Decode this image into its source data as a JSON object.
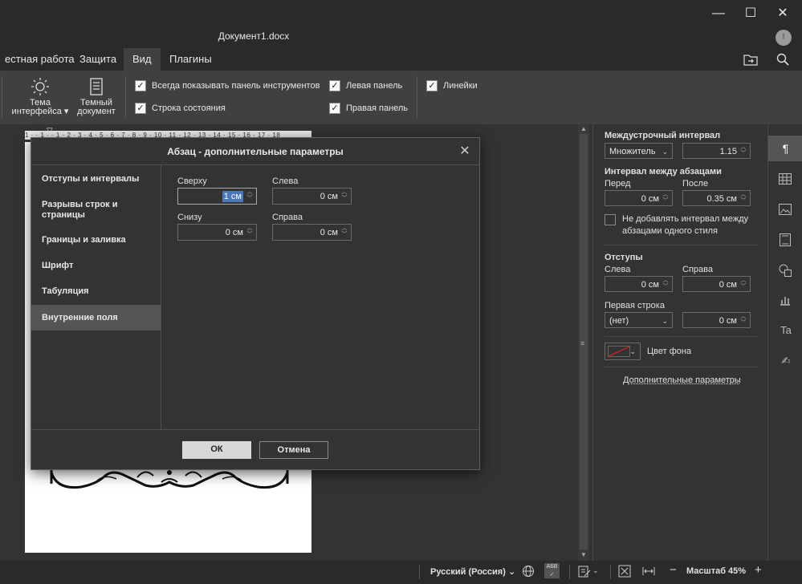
{
  "window": {
    "doc_title": "Документ1.docx",
    "avatar_initial": "I",
    "minimize": "—",
    "maximize": "☐",
    "close": "✕"
  },
  "tabs": [
    {
      "label": "естная работа"
    },
    {
      "label": "Защита"
    },
    {
      "label": "Вид"
    },
    {
      "label": "Плагины"
    }
  ],
  "toolbar": {
    "theme_label_1": "Тема",
    "theme_label_2": "интерфейса",
    "dark_label_1": "Темный",
    "dark_label_2": "документ",
    "always_show_toolbar": "Всегда показывать панель инструментов",
    "status_bar": "Строка состояния",
    "left_panel": "Левая панель",
    "right_panel": "Правая панель",
    "rulers": "Линейки"
  },
  "ruler": {
    "text": "1 · · 1 · · 1 · 2 · 3 · 4 · 5 · 6 · 7 · 8 · 9 · 10 · 11 · 12 · 13 · 14 · 15 · 16 · 17 · 18"
  },
  "right_panel": {
    "line_spacing_title": "Междустрочный интервал",
    "line_spacing_type": "Множитель",
    "line_spacing_value": "1.15",
    "paragraph_spacing_title": "Интервал между абзацами",
    "before_label": "Перед",
    "after_label": "После",
    "before_value": "0 см",
    "after_value": "0.35 см",
    "no_space_label_1": "Не добавлять интервал между",
    "no_space_label_2": "абзацами одного стиля",
    "indents_title": "Отступы",
    "left_label": "Слева",
    "right_label": "Справа",
    "left_value": "0 см",
    "right_value": "0 см",
    "first_line_label": "Первая строка",
    "first_line_type": "(нет)",
    "first_line_value": "0 см",
    "bg_color_label": "Цвет фона",
    "advanced_link": "Дополнительные параметры"
  },
  "status": {
    "language": "Русский (Россия)",
    "zoom": "Масштаб 45%",
    "spell": "АБВ"
  },
  "dialog": {
    "title": "Абзац - дополнительные параметры",
    "nav": [
      {
        "label": "Отступы и интервалы"
      },
      {
        "label": "Разрывы строк и"
      },
      {
        "label": "страницы"
      },
      {
        "label": "Границы и заливка"
      },
      {
        "label": "Шрифт"
      },
      {
        "label": "Табуляция"
      },
      {
        "label": "Внутренние поля"
      }
    ],
    "top_label": "Сверху",
    "top_value": "1 см",
    "left_label": "Слева",
    "left_value": "0 см",
    "bottom_label": "Снизу",
    "bottom_value": "0 см",
    "right_label": "Справа",
    "right_value": "0 см",
    "ok": "ОК",
    "cancel": "Отмена"
  }
}
